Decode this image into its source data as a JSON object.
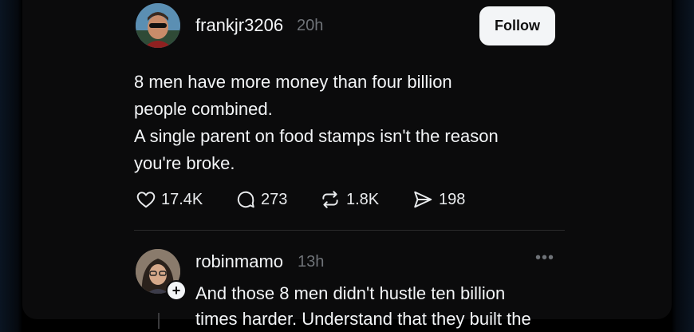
{
  "post": {
    "username": "frankjr3206",
    "time": "20h",
    "follow_label": "Follow",
    "body_lines": [
      "8 men have more money than four billion",
      "people combined.",
      "A single parent on food stamps isn't the reason",
      "you're broke."
    ],
    "likes": "17.4K",
    "comments": "273",
    "reposts": "1.8K",
    "shares": "198"
  },
  "reply": {
    "username": "robinmamo",
    "time": "13h",
    "more_label": "•••",
    "plus_label": "+",
    "body_lines": [
      "And those 8 men didn't hustle ten billion",
      "times harder. Understand that they built the"
    ]
  },
  "icons": {
    "like": "heart-icon",
    "comment": "comment-bubble-icon",
    "repost": "repost-icon",
    "share": "send-icon"
  }
}
